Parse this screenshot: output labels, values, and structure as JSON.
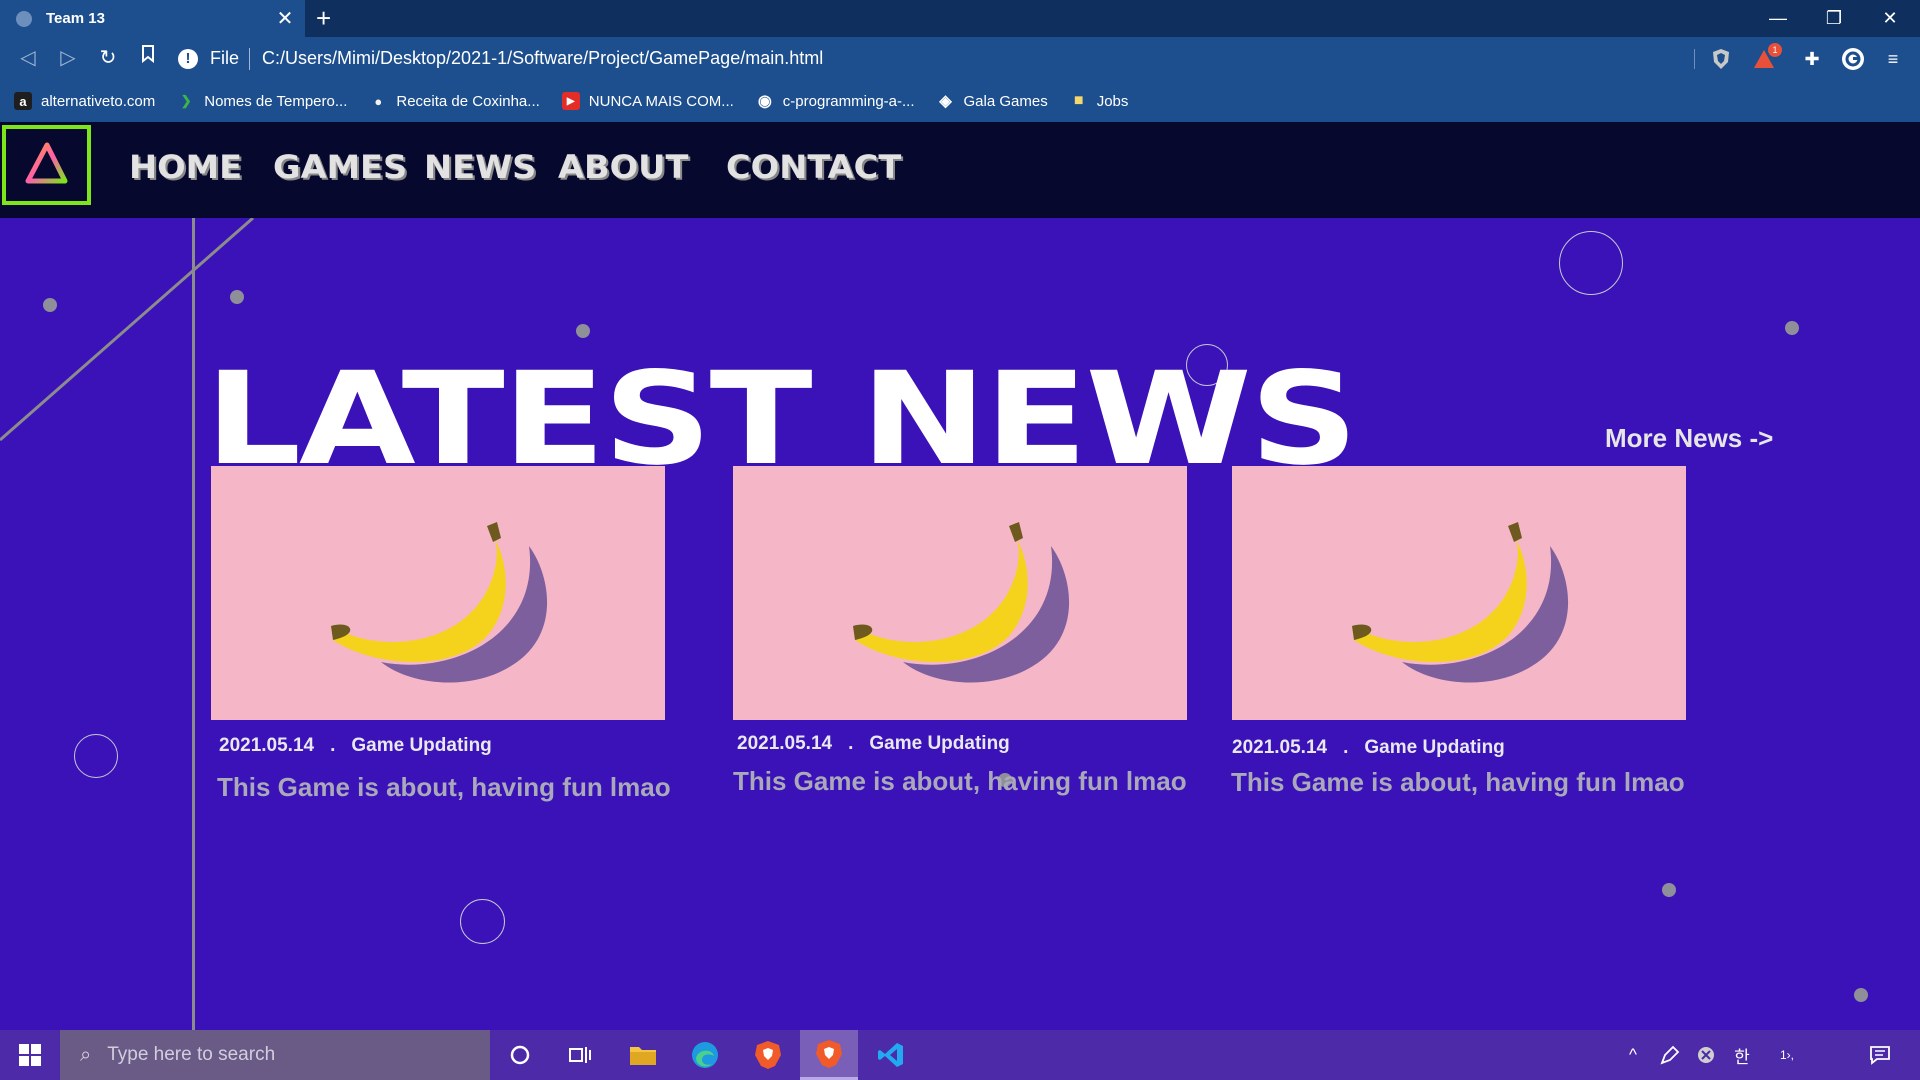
{
  "browser": {
    "tab_title": "Team 13",
    "tab_close": "✕",
    "new_tab": "+",
    "window_controls": {
      "minimize": "—",
      "restore": "❐",
      "close": "✕"
    },
    "nav": {
      "back": "◁",
      "forward": "▷",
      "reload": "↻",
      "bookmark": "🔖"
    },
    "address": {
      "info_icon": "!",
      "scheme_label": "File",
      "url": "C:/Users/Mimi/Desktop/2021-1/Software/Project/GamePage/main.html"
    },
    "extensions": {
      "brave_shield": "brave-shield-icon",
      "rewards_badge": "1",
      "puzzle": "✚",
      "grammarly": "G",
      "menu": "≡"
    },
    "bookmarks": [
      {
        "label": "alternativeto.com",
        "icon": "a",
        "color": "#1e1e1e"
      },
      {
        "label": "Nomes de Tempero...",
        "icon": "❯",
        "color": "#3bb54a"
      },
      {
        "label": "Receita de Coxinha...",
        "icon": "●",
        "color": "#f2f2f2"
      },
      {
        "label": "NUNCA MAIS COM...",
        "icon": "▶",
        "color": "#e52d27"
      },
      {
        "label": "c-programming-a-...",
        "icon": "◉",
        "color": "#ffffff"
      },
      {
        "label": "Gala Games",
        "icon": "◈",
        "color": "#ffffff"
      },
      {
        "label": "Jobs",
        "icon": "■",
        "color": "#f5d76e"
      }
    ]
  },
  "site": {
    "nav": {
      "home": "HOME",
      "games": "GAMES",
      "news": "NEWS",
      "about": "ABOUT",
      "contact": "CONTACT"
    },
    "headline": "LATEST NEWS",
    "more_news": "More News ->",
    "cards": [
      {
        "date": "2021.05.14",
        "separator": ".",
        "category": "Game Updating",
        "description": "This Game is about, having fun lmao"
      },
      {
        "date": "2021.05.14",
        "separator": ".",
        "category": "Game Updating",
        "description": "This Game is about, having fun lmao"
      },
      {
        "date": "2021.05.14",
        "separator": ".",
        "category": "Game Updating",
        "description": "This Game is about, having fun lmao"
      }
    ],
    "colors": {
      "background": "#3a12b8",
      "nav": "#06082e",
      "logo_border": "#7ce61b",
      "card": "#f5b7c7"
    }
  },
  "taskbar": {
    "search_placeholder": "Type here to search",
    "tray": {
      "chevron": "^",
      "ime": "한",
      "clock_fragment": "1›,"
    }
  }
}
